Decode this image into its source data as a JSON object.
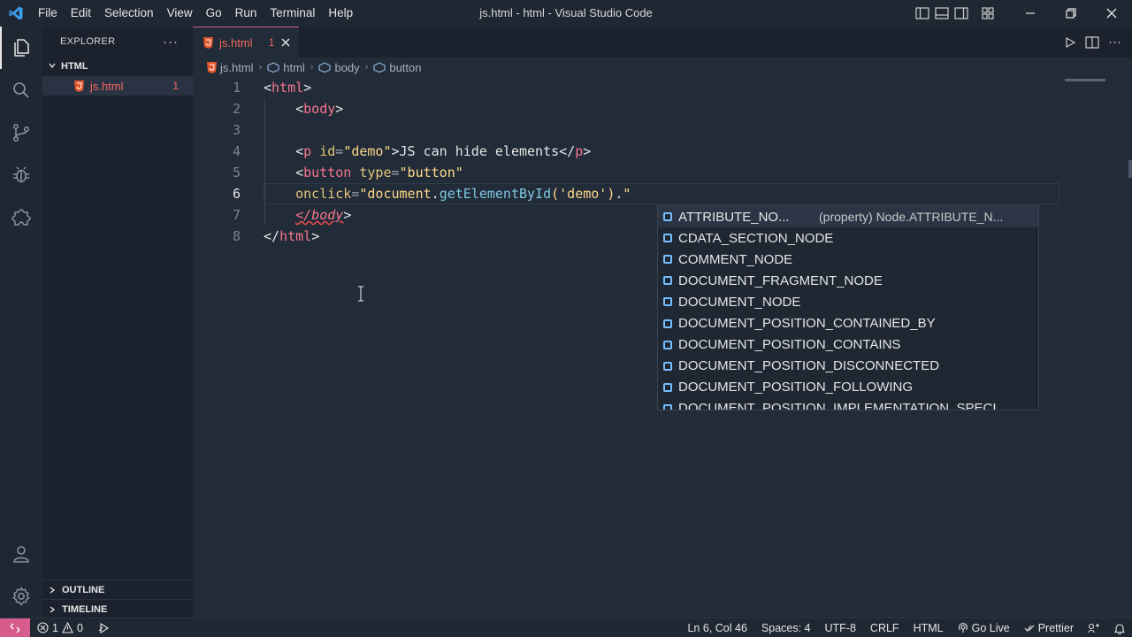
{
  "app": {
    "title": "js.html - html - Visual Studio Code"
  },
  "menu": [
    "File",
    "Edit",
    "Selection",
    "View",
    "Go",
    "Run",
    "Terminal",
    "Help"
  ],
  "sidebar": {
    "header": "EXPLORER",
    "folder": "HTML",
    "file": {
      "name": "js.html",
      "problems": "1"
    },
    "sections": [
      "OUTLINE",
      "TIMELINE"
    ]
  },
  "tab": {
    "name": "js.html",
    "problems": "1"
  },
  "breadcrumb": [
    "js.html",
    "html",
    "body",
    "button"
  ],
  "editor": {
    "lines": [
      {
        "num": "1",
        "tokens": [
          [
            "br",
            "<"
          ],
          [
            "tag",
            "html"
          ],
          [
            "br",
            ">"
          ]
        ]
      },
      {
        "num": "2",
        "tokens": [
          [
            "br",
            "    <"
          ],
          [
            "tag",
            "body"
          ],
          [
            "br",
            ">"
          ]
        ]
      },
      {
        "num": "3",
        "tokens": []
      },
      {
        "num": "4",
        "tokens": [
          [
            "br",
            "    <"
          ],
          [
            "tag",
            "p"
          ],
          [
            "br",
            " "
          ],
          [
            "attr",
            "id"
          ],
          [
            "eq",
            "="
          ],
          [
            "str",
            "\"demo\""
          ],
          [
            "br",
            ">JS can hide elements</"
          ],
          [
            "tag",
            "p"
          ],
          [
            "br",
            ">"
          ]
        ]
      },
      {
        "num": "5",
        "tokens": [
          [
            "br",
            "    <"
          ],
          [
            "tag",
            "button"
          ],
          [
            "br",
            " "
          ],
          [
            "attr",
            "type"
          ],
          [
            "eq",
            "="
          ],
          [
            "str",
            "\"button\""
          ]
        ]
      },
      {
        "num": "6",
        "tokens": [
          [
            "br",
            "    "
          ],
          [
            "attr",
            "onclick"
          ],
          [
            "eq",
            "="
          ],
          [
            "str",
            "\"document"
          ],
          [
            "br",
            "."
          ],
          [
            "fn",
            "getElementById"
          ],
          [
            "str",
            "("
          ],
          [
            "str",
            "'demo'"
          ],
          [
            "str",
            ")"
          ],
          [
            "br",
            "."
          ],
          [
            "str",
            "\""
          ]
        ]
      },
      {
        "num": "7",
        "tokens": [
          [
            "br",
            "    "
          ],
          [
            "err",
            "</body"
          ],
          [
            "br",
            ">"
          ]
        ]
      },
      {
        "num": "8",
        "tokens": [
          [
            "br",
            "</"
          ],
          [
            "tag",
            "html"
          ],
          [
            "br",
            ">"
          ]
        ]
      }
    ],
    "current_line": "6"
  },
  "suggest": {
    "items": [
      "ATTRIBUTE_NO...",
      "CDATA_SECTION_NODE",
      "COMMENT_NODE",
      "DOCUMENT_FRAGMENT_NODE",
      "DOCUMENT_NODE",
      "DOCUMENT_POSITION_CONTAINED_BY",
      "DOCUMENT_POSITION_CONTAINS",
      "DOCUMENT_POSITION_DISCONNECTED",
      "DOCUMENT_POSITION_FOLLOWING",
      "DOCUMENT_POSITION_IMPLEMENTATION_SPECI"
    ],
    "selected_detail": "(property) Node.ATTRIBUTE_N..."
  },
  "status": {
    "errors": "1",
    "warnings": "0",
    "position": "Ln 6, Col 46",
    "spaces": "Spaces: 4",
    "encoding": "UTF-8",
    "eol": "CRLF",
    "language": "HTML",
    "golive": "Go Live",
    "prettier": "Prettier"
  },
  "colors": {
    "accent": "#d65c8c",
    "background": "#222b38",
    "sidebar": "#1b222d",
    "error": "#f0685d",
    "tag": "#f7768e",
    "string": "#ffd98a",
    "function": "#7ec8e3"
  }
}
